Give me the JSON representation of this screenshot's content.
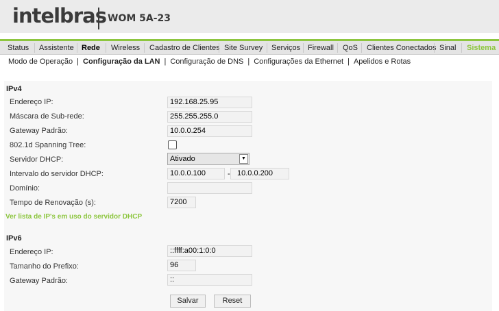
{
  "brand": {
    "logo_text": "intelbras",
    "model": "WOM 5A-23",
    "accent_color": "#8dc63f"
  },
  "nav": {
    "tabs": [
      {
        "label": "Status"
      },
      {
        "label": "Assistente"
      },
      {
        "label": "Rede"
      },
      {
        "label": "Wireless"
      },
      {
        "label": "Cadastro de Clientes"
      },
      {
        "label": "Site Survey"
      },
      {
        "label": "Serviços"
      },
      {
        "label": "Firewall"
      },
      {
        "label": "QoS"
      },
      {
        "label": "Clientes Conectados"
      },
      {
        "label": "Sinal"
      },
      {
        "label": "Sistema"
      }
    ],
    "active_tab": "Rede"
  },
  "subnav": {
    "items": [
      {
        "label": "Modo de Operação"
      },
      {
        "label": "Configuração da LAN"
      },
      {
        "label": "Configuração de DNS"
      },
      {
        "label": "Configurações da Ethernet"
      },
      {
        "label": "Apelidos e Rotas"
      }
    ],
    "separator": "|",
    "active_item": "Configuração da LAN"
  },
  "ipv4": {
    "title": "IPv4",
    "ip_label": "Endereço IP:",
    "ip_value": "192.168.25.95",
    "mask_label": "Máscara de Sub-rede:",
    "mask_value": "255.255.255.0",
    "gateway_label": "Gateway Padrão:",
    "gateway_value": "10.0.0.254",
    "stp_label": "802.1d Spanning Tree:",
    "stp_checked": false,
    "dhcp_label": "Servidor DHCP:",
    "dhcp_value": "Ativado",
    "range_label": "Intervalo do servidor DHCP:",
    "range_start": "10.0.0.100",
    "range_dash": "-",
    "range_end": "10.0.0.200",
    "domain_label": "Domínio:",
    "domain_value": "",
    "lease_label": "Tempo de Renovação (s):",
    "lease_value": "7200"
  },
  "dhcp_list_link": "Ver lista de IP's em uso do servidor DHCP",
  "ipv6": {
    "title": "IPv6",
    "ip_label": "Endereço IP:",
    "ip_value": "::ffff:a00:1:0:0",
    "prefix_label": "Tamanho do Prefixo:",
    "prefix_value": "96",
    "gateway_label": "Gateway Padrão:",
    "gateway_value": "::"
  },
  "buttons": {
    "save": "Salvar",
    "reset": "Reset"
  }
}
